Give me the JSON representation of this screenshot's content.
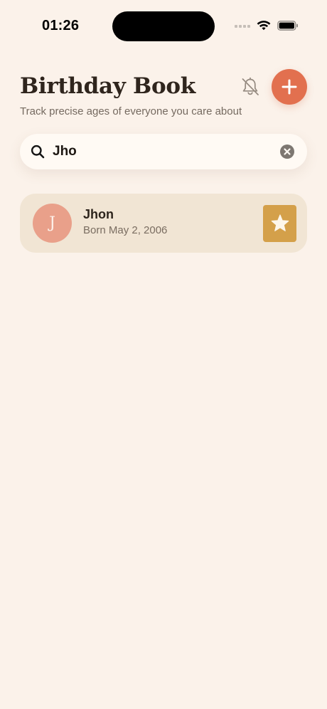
{
  "status_bar": {
    "time": "01:26"
  },
  "header": {
    "title": "Birthday Book",
    "subtitle": "Track precise ages of everyone you care about",
    "bell_icon": "bell-slash-icon",
    "add_icon": "plus-icon"
  },
  "search": {
    "value": "Jho",
    "placeholder": "Search",
    "icon": "magnifying-glass-icon",
    "clear_icon": "clear-circle-icon"
  },
  "contacts": [
    {
      "initial": "J",
      "name": "Jhon",
      "born": "Born May 2, 2006",
      "favorite": true,
      "favorite_icon": "star-icon"
    }
  ],
  "colors": {
    "background": "#fbf2ea",
    "accent": "#e2704f",
    "avatar": "#e9a08a",
    "favorite": "#d4a04a",
    "card": "#f1e5d4"
  }
}
